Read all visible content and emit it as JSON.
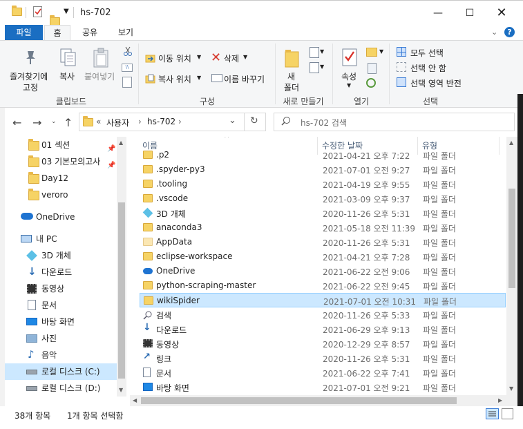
{
  "window": {
    "title": "hs-702"
  },
  "tabs": {
    "file": "파일",
    "home": "홈",
    "share": "공유",
    "view": "보기"
  },
  "ribbon": {
    "clipboard": {
      "pin": "즐겨찾기에\n고정",
      "pin1": "즐겨찾기에",
      "pin2": "고정",
      "copy": "복사",
      "paste": "붙여넣기",
      "group": "클립보드"
    },
    "organize": {
      "move_to": "이동 위치",
      "copy_to": "복사 위치",
      "delete": "삭제",
      "rename": "이름 바꾸기",
      "group": "구성"
    },
    "new": {
      "new_folder1": "새",
      "new_folder2": "폴더",
      "group": "새로 만들기"
    },
    "open": {
      "properties": "속성",
      "group": "열기"
    },
    "select": {
      "select_all": "모두 선택",
      "select_none": "선택 안 함",
      "invert": "선택 영역 반전",
      "group": "선택"
    }
  },
  "address": {
    "prefix": "«",
    "crumb1": "사용자",
    "crumb2": "hs-702"
  },
  "search": {
    "placeholder": "hs-702 검색"
  },
  "nav": {
    "items": [
      {
        "label": "01 섹션",
        "pinned": true
      },
      {
        "label": "03 기본모의고사",
        "pinned": true
      },
      {
        "label": "Day12"
      },
      {
        "label": "veroro"
      },
      {
        "label": "OneDrive"
      },
      {
        "label": "내 PC"
      },
      {
        "label": "3D 개체"
      },
      {
        "label": "다운로드"
      },
      {
        "label": "동영상"
      },
      {
        "label": "문서"
      },
      {
        "label": "바탕 화면"
      },
      {
        "label": "사진"
      },
      {
        "label": "음악"
      },
      {
        "label": "로컬 디스크 (C:)"
      },
      {
        "label": "로컬 디스크 (D:)"
      }
    ]
  },
  "columns": {
    "name": "이름",
    "date": "수정한 날짜",
    "type": "유형"
  },
  "files": [
    {
      "name": ".p2",
      "date": "2021-04-21 오후 7:22",
      "type": "파일 폴더",
      "icon": "folder"
    },
    {
      "name": ".spyder-py3",
      "date": "2021-07-01 오전 9:27",
      "type": "파일 폴더",
      "icon": "folder"
    },
    {
      "name": ".tooling",
      "date": "2021-04-19 오후 9:55",
      "type": "파일 폴더",
      "icon": "folder"
    },
    {
      "name": ".vscode",
      "date": "2021-03-09 오후 9:37",
      "type": "파일 폴더",
      "icon": "folder"
    },
    {
      "name": "3D 개체",
      "date": "2020-11-26 오후 5:31",
      "type": "파일 폴더",
      "icon": "3d"
    },
    {
      "name": "anaconda3",
      "date": "2021-05-18 오전 11:39",
      "type": "파일 폴더",
      "icon": "folder"
    },
    {
      "name": "AppData",
      "date": "2020-11-26 오후 5:31",
      "type": "파일 폴더",
      "icon": "folder-light"
    },
    {
      "name": "eclipse-workspace",
      "date": "2021-04-21 오후 7:28",
      "type": "파일 폴더",
      "icon": "folder"
    },
    {
      "name": "OneDrive",
      "date": "2021-06-22 오전 9:06",
      "type": "파일 폴더",
      "icon": "cloud"
    },
    {
      "name": "python-scraping-master",
      "date": "2021-06-22 오전 9:45",
      "type": "파일 폴더",
      "icon": "folder"
    },
    {
      "name": "wikiSpider",
      "date": "2021-07-01 오전 10:31",
      "type": "파일 폴더",
      "icon": "folder"
    },
    {
      "name": "검색",
      "date": "2020-11-26 오후 5:33",
      "type": "파일 폴더",
      "icon": "search"
    },
    {
      "name": "다운로드",
      "date": "2021-06-29 오후 9:13",
      "type": "파일 폴더",
      "icon": "download"
    },
    {
      "name": "동영상",
      "date": "2020-12-29 오후 8:57",
      "type": "파일 폴더",
      "icon": "video"
    },
    {
      "name": "링크",
      "date": "2020-11-26 오후 5:31",
      "type": "파일 폴더",
      "icon": "link"
    },
    {
      "name": "문서",
      "date": "2021-06-22 오후 7:41",
      "type": "파일 폴더",
      "icon": "doc"
    },
    {
      "name": "바탕 화면",
      "date": "2021-07-01 오전 9:21",
      "type": "파일 폴더",
      "icon": "desktop"
    }
  ],
  "selected_file": "wikiSpider",
  "status": {
    "count": "38개 항목",
    "selected": "1개 항목 선택함"
  },
  "colors": {
    "accent": "#1a6ec2",
    "selection": "#cce8ff",
    "folder": "#f6d365"
  }
}
